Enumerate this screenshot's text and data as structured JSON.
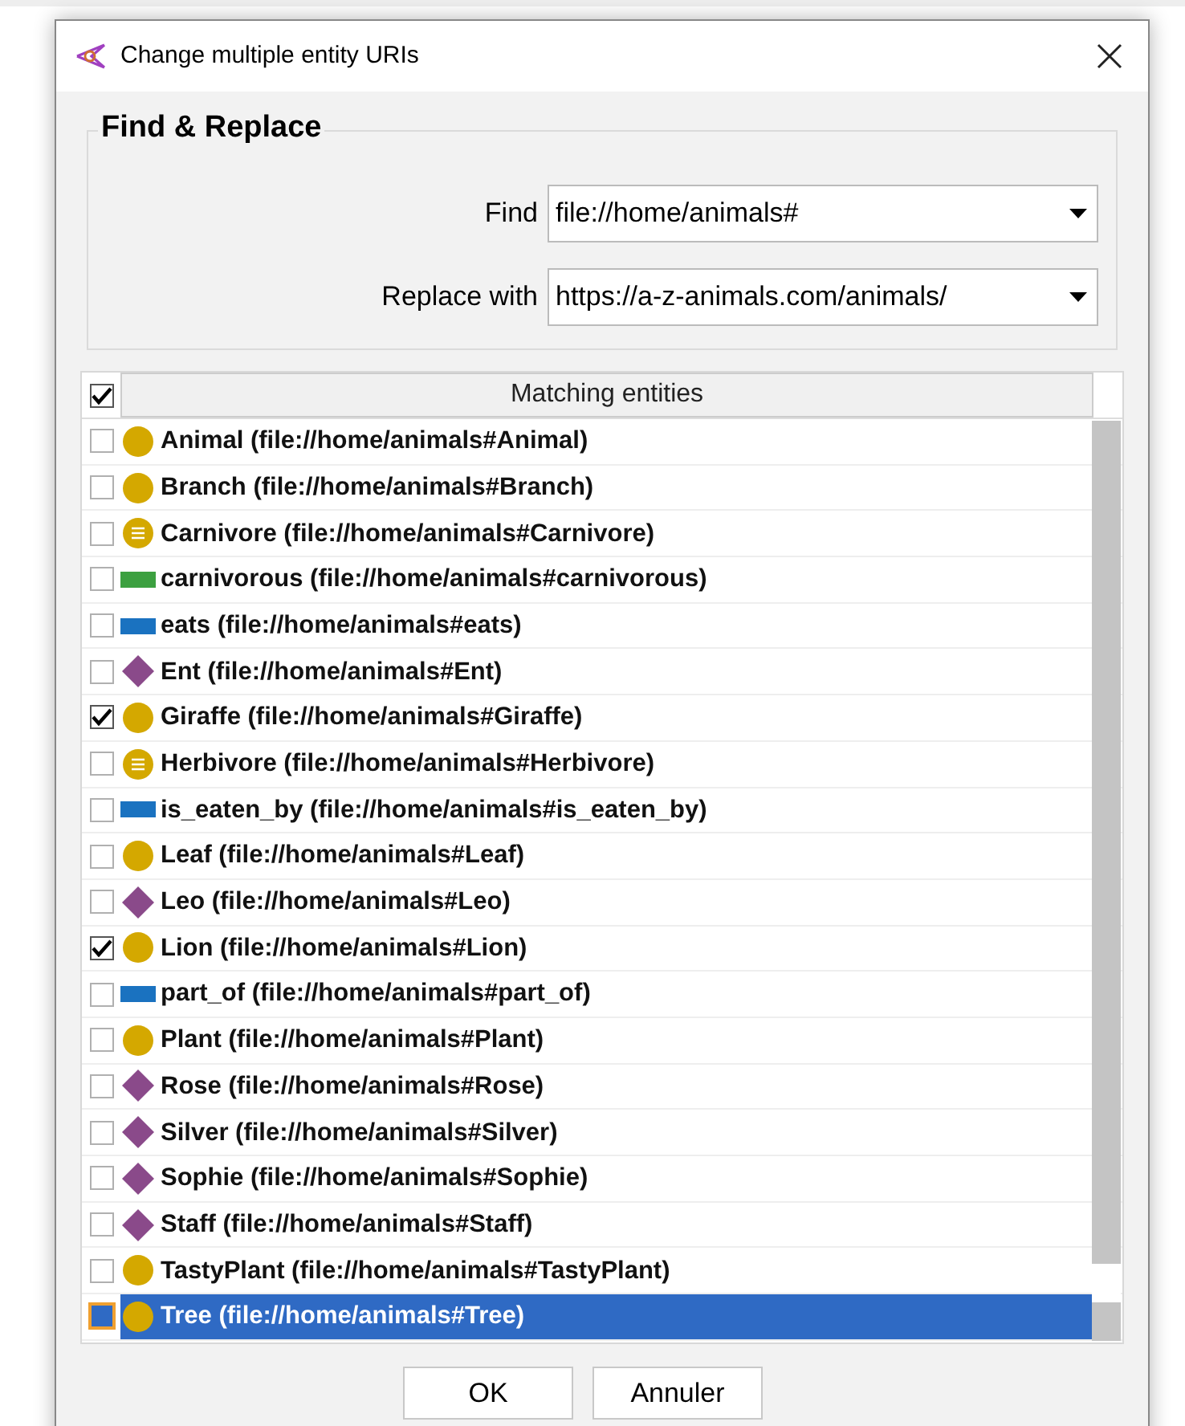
{
  "window": {
    "title": "Change multiple entity URIs"
  },
  "find_replace": {
    "title": "Find & Replace",
    "find": {
      "label": "Find",
      "value": "file://home/animals#"
    },
    "replace": {
      "label": "Replace with",
      "value": "https://a-z-animals.com/animals/"
    }
  },
  "table": {
    "header": {
      "checked": true,
      "label": "Matching entities"
    },
    "rows": [
      {
        "kind": "class",
        "label": "Animal (file://home/animals#Animal)",
        "checked": false,
        "selected": false
      },
      {
        "kind": "class",
        "label": "Branch (file://home/animals#Branch)",
        "checked": false,
        "selected": false
      },
      {
        "kind": "defined",
        "label": "Carnivore (file://home/animals#Carnivore)",
        "checked": false,
        "selected": false
      },
      {
        "kind": "data",
        "label": "carnivorous (file://home/animals#carnivorous)",
        "checked": false,
        "selected": false
      },
      {
        "kind": "object",
        "label": "eats (file://home/animals#eats)",
        "checked": false,
        "selected": false
      },
      {
        "kind": "individual",
        "label": "Ent (file://home/animals#Ent)",
        "checked": false,
        "selected": false
      },
      {
        "kind": "class",
        "label": "Giraffe (file://home/animals#Giraffe)",
        "checked": true,
        "selected": false
      },
      {
        "kind": "defined",
        "label": "Herbivore (file://home/animals#Herbivore)",
        "checked": false,
        "selected": false
      },
      {
        "kind": "object",
        "label": "is_eaten_by (file://home/animals#is_eaten_by)",
        "checked": false,
        "selected": false
      },
      {
        "kind": "class",
        "label": "Leaf (file://home/animals#Leaf)",
        "checked": false,
        "selected": false
      },
      {
        "kind": "individual",
        "label": "Leo (file://home/animals#Leo)",
        "checked": false,
        "selected": false
      },
      {
        "kind": "class",
        "label": "Lion (file://home/animals#Lion)",
        "checked": true,
        "selected": false
      },
      {
        "kind": "object",
        "label": "part_of (file://home/animals#part_of)",
        "checked": false,
        "selected": false
      },
      {
        "kind": "class",
        "label": "Plant (file://home/animals#Plant)",
        "checked": false,
        "selected": false
      },
      {
        "kind": "individual",
        "label": "Rose (file://home/animals#Rose)",
        "checked": false,
        "selected": false
      },
      {
        "kind": "individual",
        "label": "Silver (file://home/animals#Silver)",
        "checked": false,
        "selected": false
      },
      {
        "kind": "individual",
        "label": "Sophie (file://home/animals#Sophie)",
        "checked": false,
        "selected": false
      },
      {
        "kind": "individual",
        "label": "Staff (file://home/animals#Staff)",
        "checked": false,
        "selected": false
      },
      {
        "kind": "class",
        "label": "TastyPlant (file://home/animals#TastyPlant)",
        "checked": false,
        "selected": false
      },
      {
        "kind": "class",
        "label": "Tree (file://home/animals#Tree)",
        "checked": false,
        "selected": true
      }
    ]
  },
  "buttons": [
    "OK",
    "Annuler"
  ]
}
